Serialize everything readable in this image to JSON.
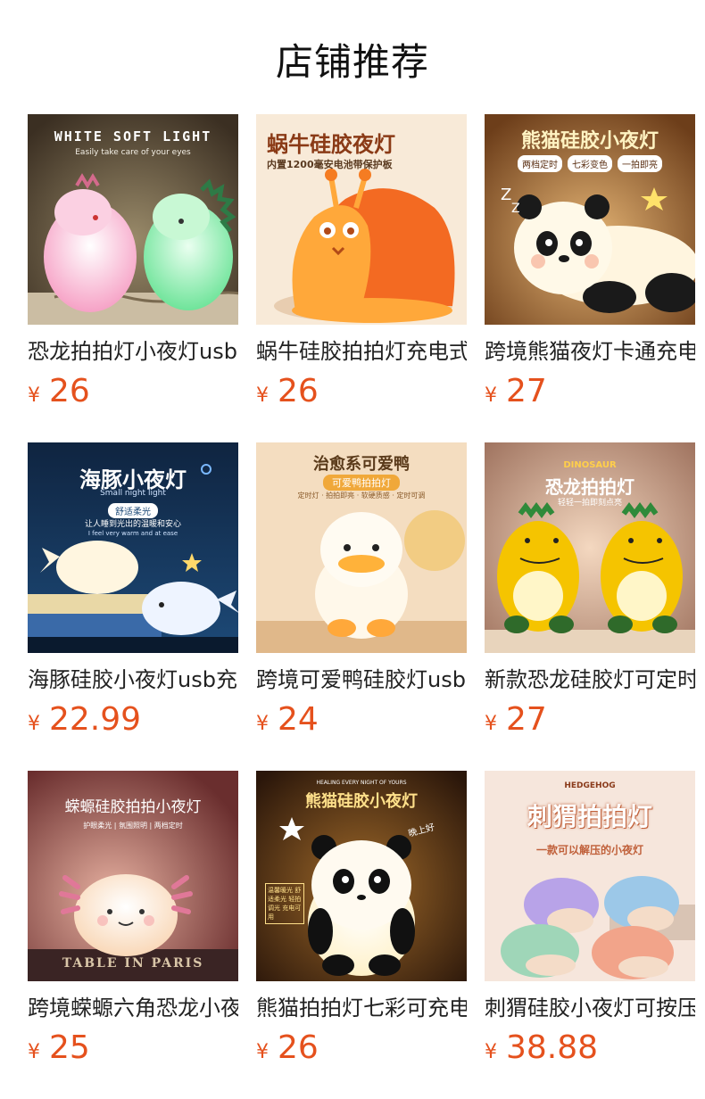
{
  "title": "店铺推荐",
  "currency": "¥",
  "products": [
    {
      "name": "恐龙拍拍灯小夜灯usb充电",
      "price": "26",
      "icon": "dinosaur-lamp",
      "overlay": {
        "headline": "WHITE SOFT LIGHT",
        "sub": "Easily take care of your eyes"
      }
    },
    {
      "name": "蜗牛硅胶拍拍灯充电式",
      "price": "26",
      "icon": "snail-lamp",
      "overlay": {
        "headline": "蜗牛硅胶夜灯",
        "sub": "内置1200毫安电池带保护板"
      }
    },
    {
      "name": "跨境熊猫夜灯卡通充电",
      "price": "27",
      "icon": "panda-lamp",
      "overlay": {
        "headline": "熊猫硅胶小夜灯",
        "tags": [
          "两档定时",
          "七彩变色",
          "一拍即亮"
        ]
      }
    },
    {
      "name": "海豚硅胶小夜灯usb充电",
      "price": "22.99",
      "icon": "whale-lamp",
      "overlay": {
        "headline": "海豚小夜灯",
        "sub": "Small night light",
        "badge": "舒适柔光",
        "sub2": "让人睡到光出的温暖和安心",
        "sub3": "I feel very warm and at ease"
      }
    },
    {
      "name": "跨境可爱鸭硅胶灯usb",
      "price": "24",
      "icon": "duck-lamp",
      "overlay": {
        "headline": "治愈系可爱鸭",
        "badge": "可爱鸭拍拍灯",
        "sub": "定时灯 · 拍拍即亮 · 软硬质感 · 定时可调"
      }
    },
    {
      "name": "新款恐龙硅胶灯可定时",
      "price": "27",
      "icon": "dinosaur-lamp",
      "overlay": {
        "headline": "恐龙拍拍灯",
        "top": "DINOSAUR",
        "sub": "轻轻一拍即刻点亮"
      }
    },
    {
      "name": "跨境蝾螈六角恐龙小夜灯",
      "price": "25",
      "icon": "axolotl-lamp",
      "overlay": {
        "headline": "蝾螈硅胶拍拍小夜灯",
        "sub": "护眼柔光 | 氛围照明 | 两档定时",
        "base": "TABLE IN PARIS"
      }
    },
    {
      "name": "熊猫拍拍灯七彩可充电",
      "price": "26",
      "icon": "panda-lamp",
      "overlay": {
        "top": "HEALING EVERY NIGHT OF YOURS",
        "headline": "熊猫硅胶小夜灯",
        "side": "晚上好",
        "tag": "温馨暖光 舒适柔光 轻拍调光 充电可用"
      }
    },
    {
      "name": "刺猬硅胶小夜灯可按压",
      "price": "38.88",
      "icon": "hedgehog-lamp",
      "overlay": {
        "top": "HEDGEHOG",
        "headline": "刺猬拍拍灯",
        "sub": "一款可以解压的小夜灯"
      }
    }
  ]
}
